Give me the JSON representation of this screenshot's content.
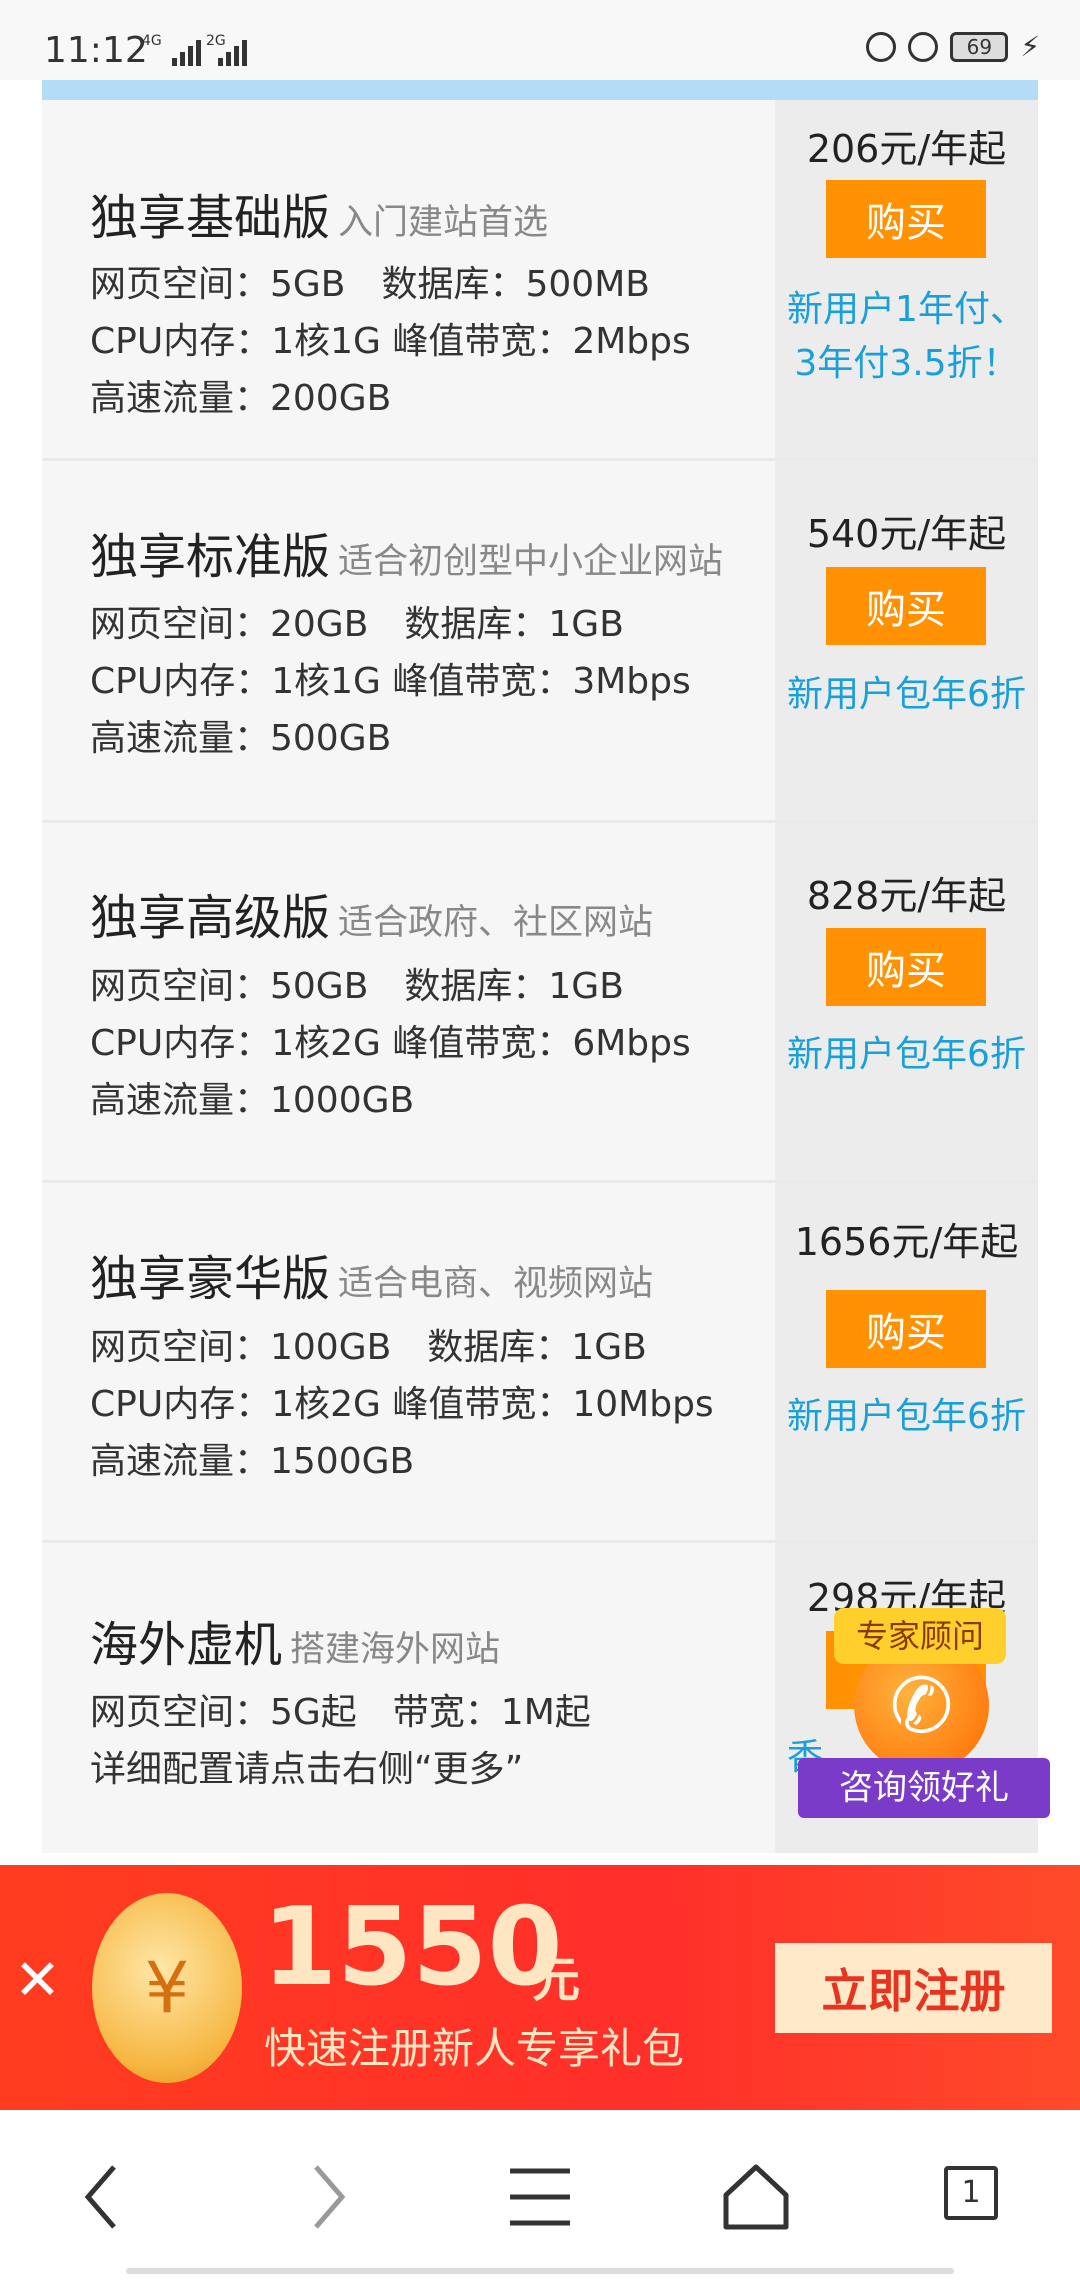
{
  "status_bar": {
    "time": "11:12",
    "network_1": "4G",
    "network_2": "2G",
    "battery": "69"
  },
  "plans": [
    {
      "name": "独享基础版",
      "subtitle": "入门建站首选",
      "lines": [
        "网页空间：5GB　数据库：500MB",
        "CPU内存：1核1G  峰值带宽：2Mbps",
        "高速流量：200GB"
      ],
      "price": "206元/年起",
      "buy_label": "购买",
      "promo": "新用户1年付、3年付3.5折！"
    },
    {
      "name": "独享标准版",
      "subtitle": "适合初创型中小企业网站",
      "lines": [
        "网页空间：20GB　数据库：1GB",
        "CPU内存：1核1G  峰值带宽：3Mbps",
        "高速流量：500GB"
      ],
      "price": "540元/年起",
      "buy_label": "购买",
      "promo": "新用户包年6折"
    },
    {
      "name": "独享高级版",
      "subtitle": "适合政府、社区网站",
      "lines": [
        "网页空间：50GB　数据库：1GB",
        "CPU内存：1核2G  峰值带宽：6Mbps",
        "高速流量：1000GB"
      ],
      "price": "828元/年起",
      "buy_label": "购买",
      "promo": "新用户包年6折"
    },
    {
      "name": "独享豪华版",
      "subtitle": "适合电商、视频网站",
      "lines": [
        "网页空间：100GB　数据库：1GB",
        "CPU内存：1核2G 峰值带宽：10Mbps",
        "高速流量：1500GB"
      ],
      "price": "1656元/年起",
      "buy_label": "购买",
      "promo": "新用户包年6折"
    },
    {
      "name": "海外虚机",
      "subtitle": "搭建海外网站",
      "lines": [
        "网页空间：5G起　带宽：1M起",
        "详细配置请点击右侧“更多”"
      ],
      "price": "298元/年起",
      "buy_label": "购买",
      "promo": "香"
    }
  ],
  "consultant": {
    "top_label": "专家顾问",
    "bottom_label": "咨询领好礼",
    "icon": "phone-icon"
  },
  "banner": {
    "amount": "1550",
    "unit": "元",
    "description": "快速注册新人专享礼包",
    "register_label": "立即注册",
    "coin_symbol": "¥"
  },
  "navigation": {
    "tab_count": "1"
  },
  "colors": {
    "buy_button": "#ff9102",
    "promo_text": "#1aa0d8",
    "banner_bg": "#ff3c1f"
  }
}
